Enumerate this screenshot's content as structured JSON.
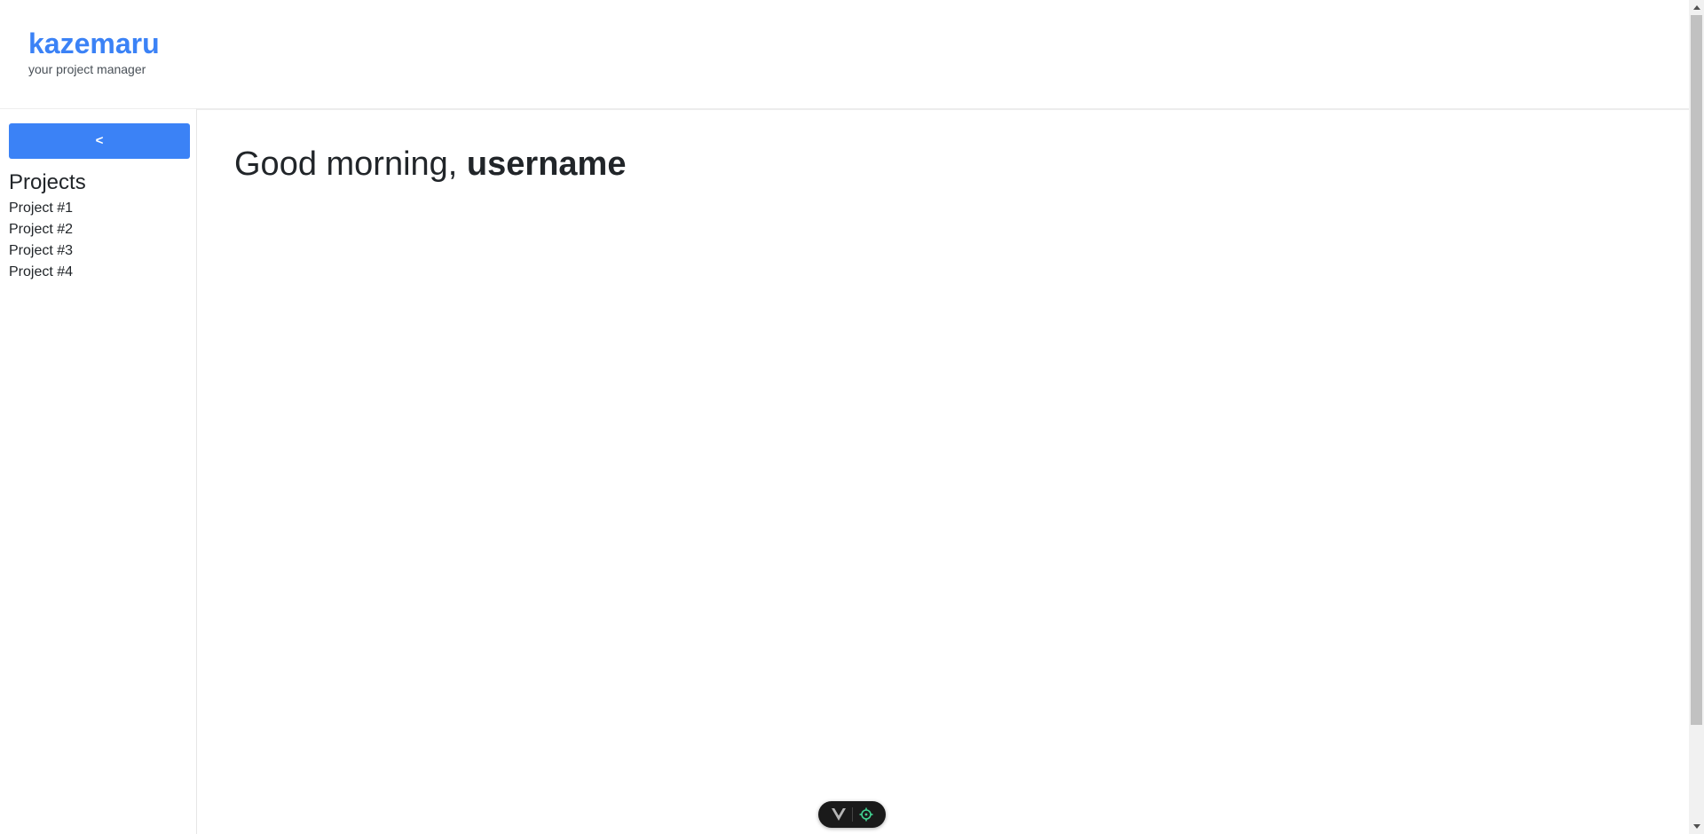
{
  "header": {
    "brand_name": "kazemaru",
    "tagline": "your project manager"
  },
  "sidebar": {
    "collapse_label": "<",
    "projects_heading": "Projects",
    "projects": [
      {
        "label": "Project #1"
      },
      {
        "label": "Project #2"
      },
      {
        "label": "Project #3"
      },
      {
        "label": "Project #4"
      }
    ]
  },
  "main": {
    "greeting_prefix": "Good morning, ",
    "username": "username"
  },
  "dev_toolbar": {
    "icons": [
      "vue-logo-icon",
      "crosshair-target-icon"
    ]
  },
  "colors": {
    "accent": "#3b82f6",
    "dev_toolbar_bg": "#1a1a1a",
    "dev_logo": "#b5b5b5",
    "dev_target": "#42d392"
  }
}
